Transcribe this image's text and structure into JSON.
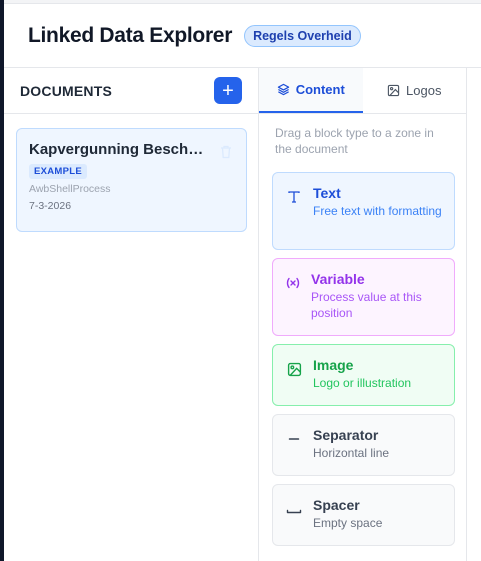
{
  "app": {
    "title": "Linked Data Explorer",
    "badge": "Regels Overheid"
  },
  "documents": {
    "heading": "DOCUMENTS",
    "add_label": "+",
    "items": [
      {
        "name": "Kapvergunning Beschik...",
        "tag": "EXAMPLE",
        "process": "AwbShellProcess",
        "date": "7-3-2026"
      }
    ]
  },
  "blocks_panel": {
    "tabs": [
      {
        "label": "Content",
        "icon": "layers-icon",
        "active": true
      },
      {
        "label": "Logos",
        "icon": "image-icon",
        "active": false
      }
    ],
    "hint": "Drag a block type to a zone in the document",
    "blocks": [
      {
        "title": "Text",
        "description": "Free text with formatting",
        "icon": "text-icon",
        "color": "#1d4ed8"
      },
      {
        "title": "Variable",
        "description": "Process value at this position",
        "icon": "variable-icon",
        "color": "#9333ea"
      },
      {
        "title": "Image",
        "description": "Logo or illustration",
        "icon": "image-icon",
        "color": "#16a34a"
      },
      {
        "title": "Separator",
        "description": "Horizontal line",
        "icon": "separator-icon",
        "color": "#374151"
      },
      {
        "title": "Spacer",
        "description": "Empty space",
        "icon": "spacer-icon",
        "color": "#374151"
      }
    ]
  },
  "colors": {
    "accent": "#2563eb",
    "rail": "#0f172a"
  }
}
